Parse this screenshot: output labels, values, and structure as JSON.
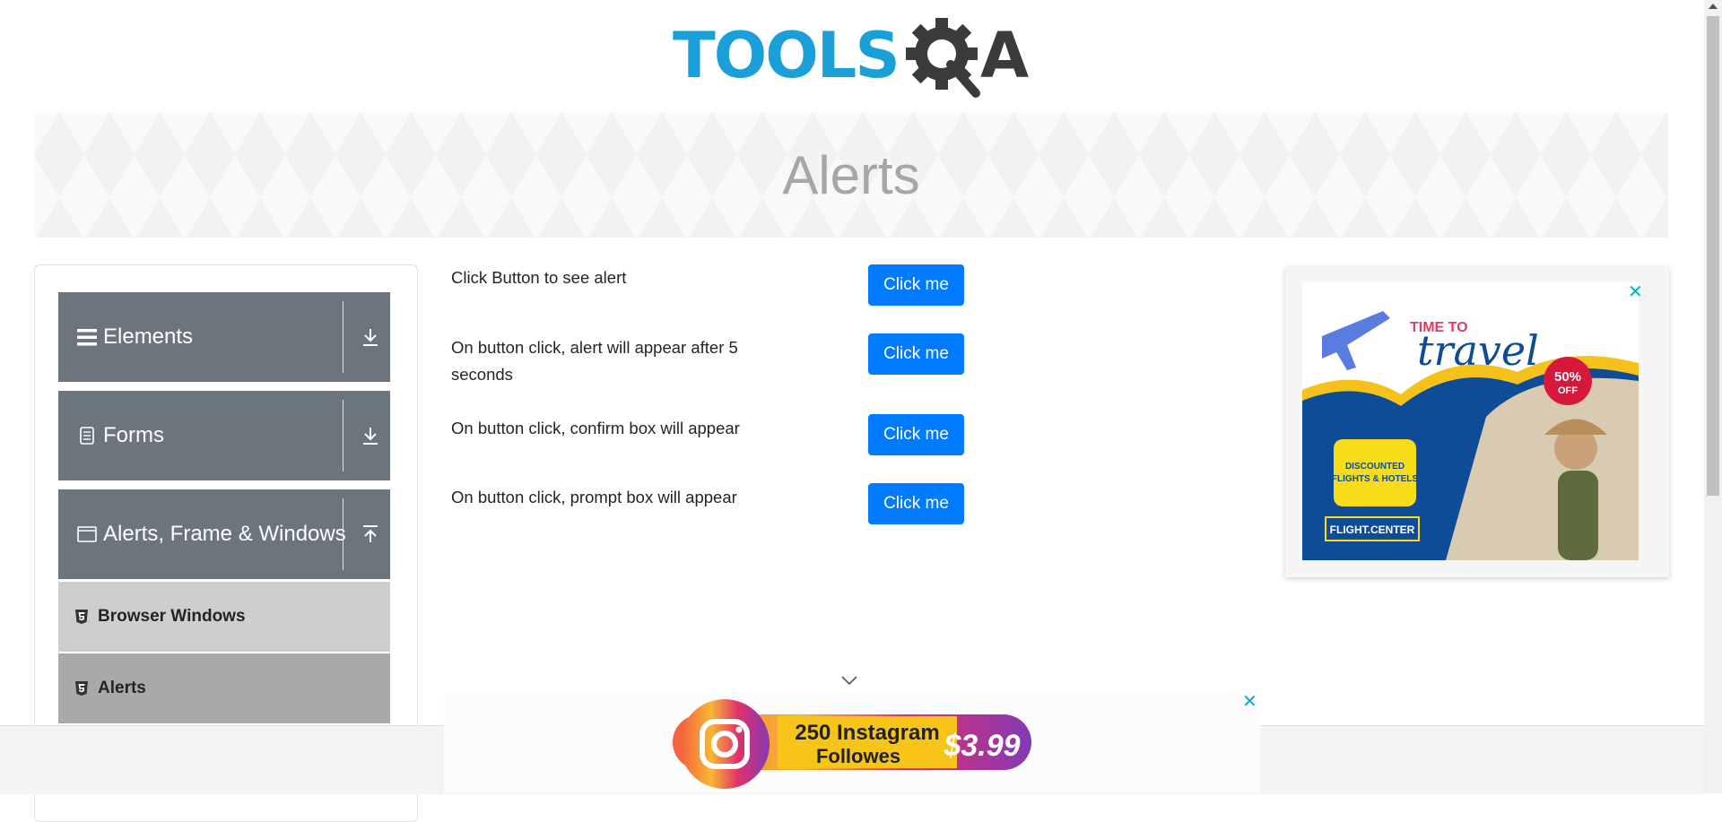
{
  "logo": {
    "text_main": "TOOLS",
    "text_q": "Q",
    "text_a": "A"
  },
  "page_title": "Alerts",
  "sidebar": {
    "groups": [
      {
        "label": "Elements",
        "icon": "hamburger-icon",
        "arrow": "download-arrow-icon"
      },
      {
        "label": "Forms",
        "icon": "document-icon",
        "arrow": "download-arrow-icon"
      },
      {
        "label": "Alerts, Frame & Windows",
        "icon": "window-icon",
        "arrow": "upload-arrow-icon"
      }
    ],
    "items": [
      {
        "label": "Browser Windows",
        "icon": "html5-icon",
        "active": false
      },
      {
        "label": "Alerts",
        "icon": "html5-icon",
        "active": true
      }
    ]
  },
  "alerts": [
    {
      "text": "Click Button to see alert",
      "button": "Click me"
    },
    {
      "text": "On button click, alert will appear after 5 seconds",
      "button": "Click me"
    },
    {
      "text": "On button click, confirm box will appear",
      "button": "Click me"
    },
    {
      "text": "On button click, prompt box will appear",
      "button": "Click me"
    }
  ],
  "right_ad": {
    "headline_small": "TIME TO",
    "headline_big": "travel",
    "discount": "50%",
    "discount_suffix": "OFF",
    "badge_line1": "DISCOUNTED",
    "badge_line2": "FLIGHTS & HOTELS",
    "brand": "FLIGHT.CENTER",
    "close": "✕"
  },
  "bottom_ad": {
    "line1": "250 Instagram",
    "line2": "Followes",
    "price": "$3.99",
    "close": "✕"
  },
  "colors": {
    "primary": "#007bff",
    "sidebar_group": "#6c757d",
    "logo_blue": "#1a9fd8",
    "logo_dark": "#3b3b3b",
    "ad_close": "#00aecd"
  }
}
